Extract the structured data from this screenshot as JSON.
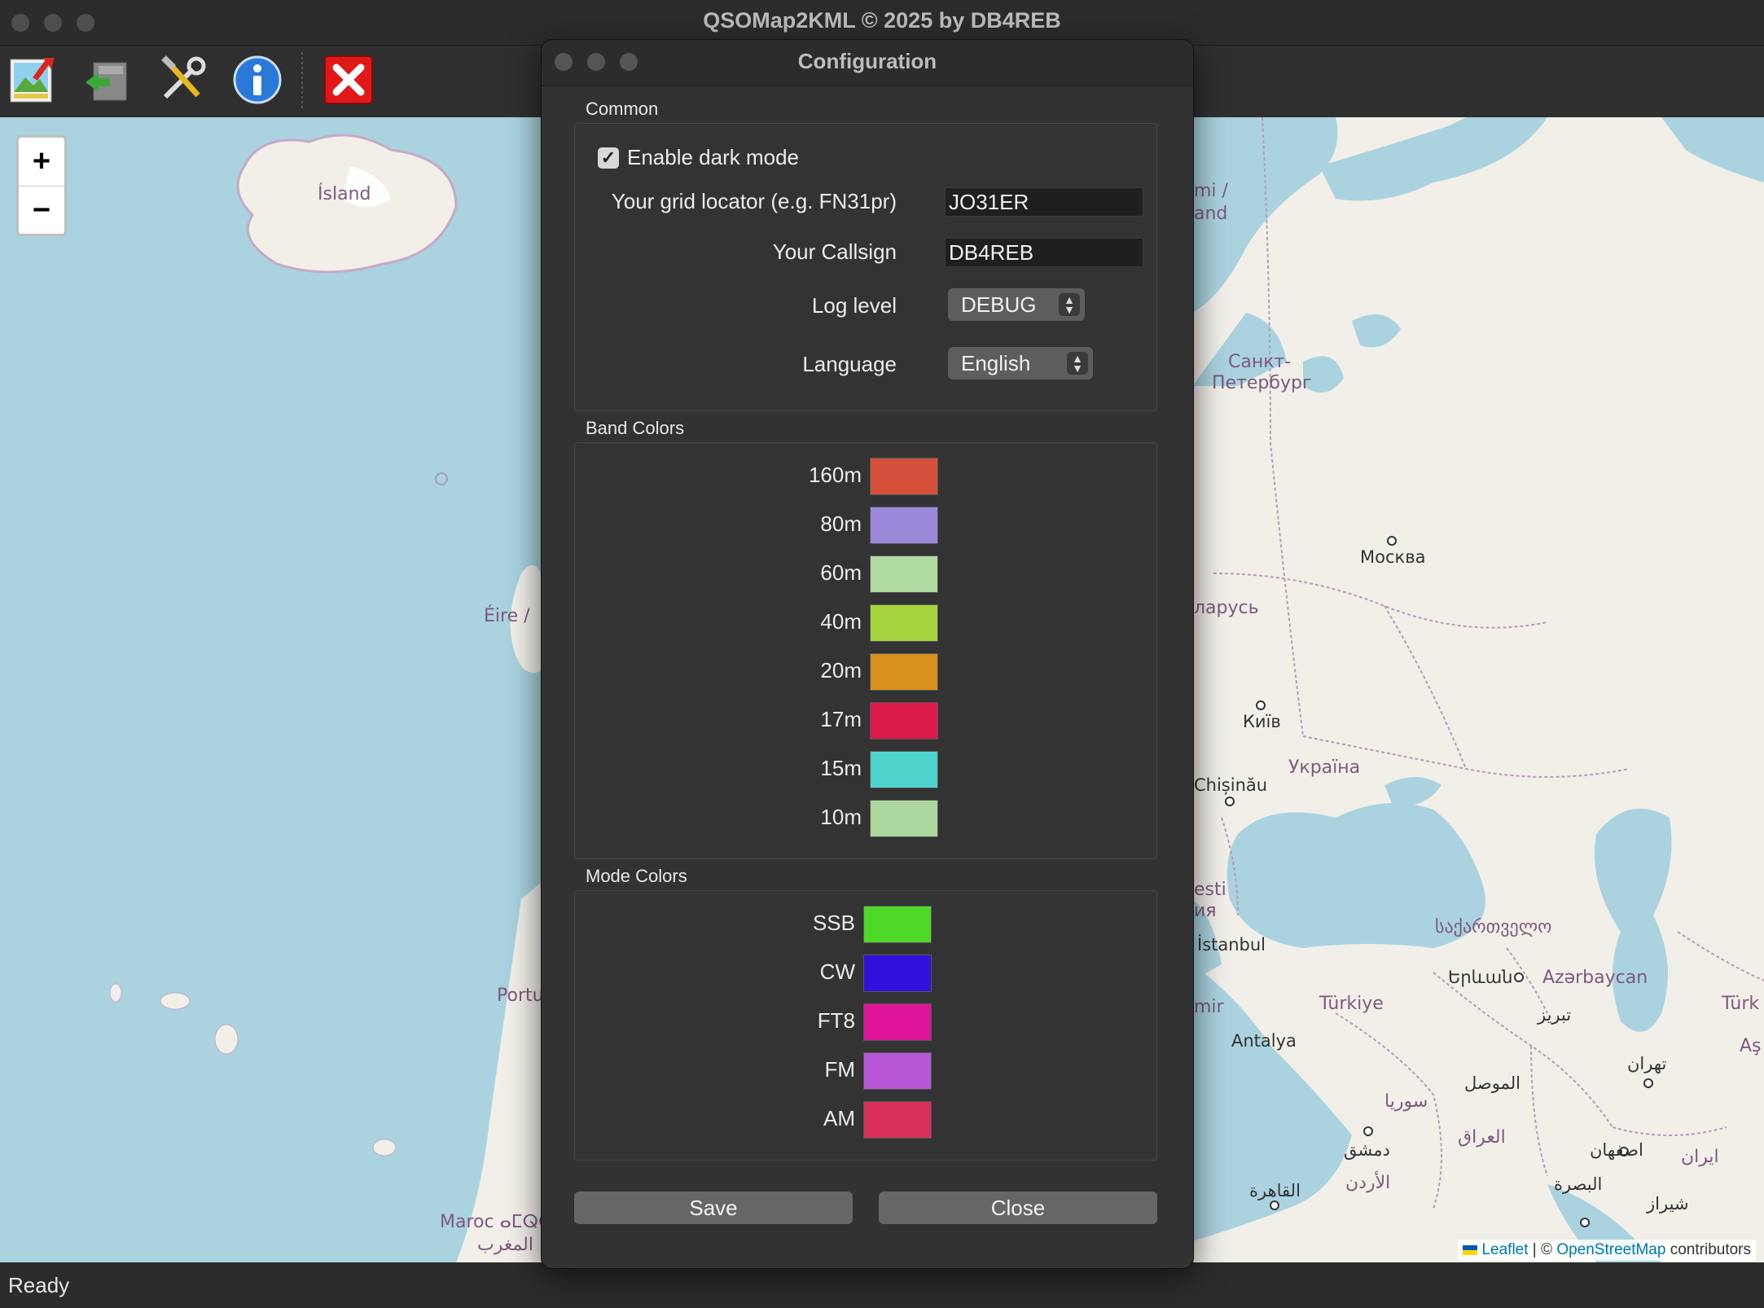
{
  "window": {
    "title": "QSOMap2KML © 2025 by DB4REB"
  },
  "toolbar": {
    "buttons": [
      {
        "icon": "import-image-icon"
      },
      {
        "icon": "export-icon"
      },
      {
        "icon": "settings-tools-icon"
      },
      {
        "icon": "info-icon"
      },
      {
        "icon": "close-red-icon"
      }
    ]
  },
  "map": {
    "zoom_in": "+",
    "zoom_out": "−",
    "labels": {
      "iceland": "Ísland",
      "eire": "Éire /",
      "sankt": "Санкт-",
      "peterburg": "Петербург",
      "moskva": "Москва",
      "kyiv": "Київ",
      "ukraina": "Україна",
      "chisinau": "Chișinău",
      "istanbul": "İstanbul",
      "turkiye": "Türkiye",
      "antalya": "Antalya",
      "yerevan": "Երևան",
      "azerbaycan": "Azərbaycan",
      "georgia": "საქართველო",
      "mosul": "الموصل",
      "syria": "سوريا",
      "damascus": "دمشق",
      "iraq": "العراق",
      "isfahan": "اصفهان",
      "iran": "ايران",
      "tehran": "تهران",
      "tabriz": "تبریز",
      "basra": "البصرة",
      "shiraz": "شیراز",
      "jordan": "الأردن",
      "cairo": "القاهرة",
      "portugal": "Portu",
      "maroc": "Maroc ⴰⵎⵕⵕⵓⴽ",
      "maghrib": "المغرب",
      "larus": "ларусь",
      "mi": "mi /",
      "and": "and",
      "esti": "esti",
      "ia": "ия",
      "mir": "mir",
      "turk": "Türk",
      "as": "Aş"
    },
    "attribution": {
      "leaflet": "Leaflet",
      "sep": " | © ",
      "osm": "OpenStreetMap",
      "suffix": " contributors"
    }
  },
  "status": {
    "text": "Ready"
  },
  "dialog": {
    "title": "Configuration",
    "common": {
      "label": "Common",
      "dark_mode_label": "Enable dark mode",
      "dark_mode_checked": true,
      "grid_label": "Your grid locator (e.g. FN31pr)",
      "grid_value": "JO31ER",
      "callsign_label": "Your Callsign",
      "callsign_value": "DB4REB",
      "loglevel_label": "Log level",
      "loglevel_value": "DEBUG",
      "language_label": "Language",
      "language_value": "English"
    },
    "band_colors": {
      "label": "Band Colors",
      "items": [
        {
          "band": "160m",
          "color": "#d4503a"
        },
        {
          "band": "80m",
          "color": "#9a88d8"
        },
        {
          "band": "60m",
          "color": "#b0dca2"
        },
        {
          "band": "40m",
          "color": "#a6d43e"
        },
        {
          "band": "20m",
          "color": "#d8901e"
        },
        {
          "band": "17m",
          "color": "#dc1a4a"
        },
        {
          "band": "15m",
          "color": "#4ed4cc"
        },
        {
          "band": "10m",
          "color": "#acd8a0"
        }
      ]
    },
    "mode_colors": {
      "label": "Mode Colors",
      "items": [
        {
          "mode": "SSB",
          "color": "#4ed828"
        },
        {
          "mode": "CW",
          "color": "#3012dc"
        },
        {
          "mode": "FT8",
          "color": "#e0149a"
        },
        {
          "mode": "FM",
          "color": "#b858d8"
        },
        {
          "mode": "AM",
          "color": "#d8305a"
        }
      ]
    },
    "save_label": "Save",
    "close_label": "Close"
  }
}
